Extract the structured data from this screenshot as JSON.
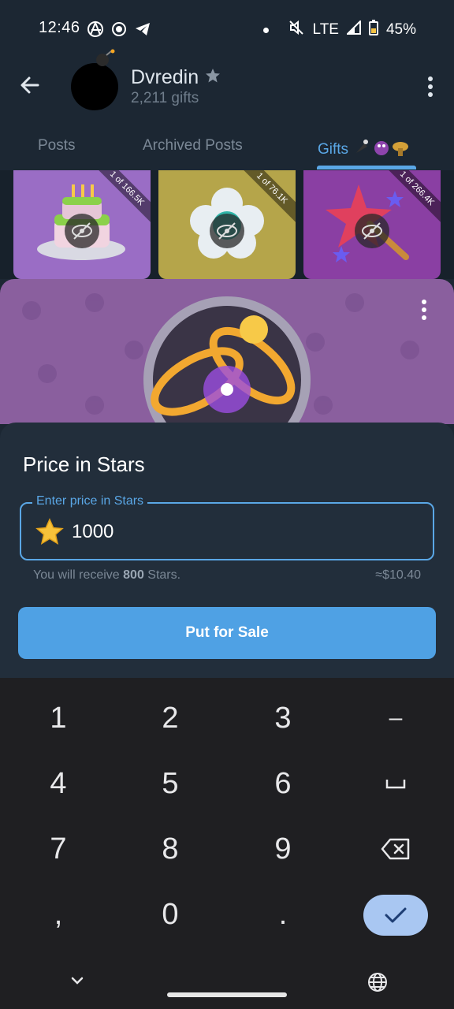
{
  "status_bar": {
    "time": "12:46",
    "network": "LTE",
    "battery": "45%"
  },
  "header": {
    "name": "Dvredin",
    "subtitle": "2,211 gifts",
    "tabs": [
      {
        "label": "Posts",
        "active": false
      },
      {
        "label": "Archived Posts",
        "active": false
      },
      {
        "label": "Gifts",
        "active": true
      }
    ]
  },
  "gift_strip": [
    {
      "edition": "1 of 166.5K",
      "color": "#9a6dc5",
      "subject": "cake"
    },
    {
      "edition": "1 of 76.1K",
      "color": "#b5a54a",
      "subject": "flower"
    },
    {
      "edition": "1 of 266.4K",
      "color": "#8a3fa3",
      "subject": "magic-wand"
    }
  ],
  "preview": {
    "background": "#8a5f9e"
  },
  "sheet": {
    "title": "Price in Stars",
    "field_label": "Enter price in Stars",
    "field_value": "1000",
    "receive_prefix": "You will receive ",
    "receive_amount": "800",
    "receive_suffix": " Stars.",
    "usd_estimate": "≈$10.40",
    "button_label": "Put for Sale"
  },
  "keyboard": {
    "rows": [
      [
        "1",
        "2",
        "3",
        "–"
      ],
      [
        "4",
        "5",
        "6",
        "␣"
      ],
      [
        "7",
        "8",
        "9",
        "⌫"
      ],
      [
        ",",
        "0",
        ".",
        "✓"
      ]
    ]
  },
  "colors": {
    "accent": "#5aa7e6",
    "button": "#4fa1e4",
    "sheet_bg": "#222e3b",
    "keyboard_bg": "#1f1f22"
  }
}
